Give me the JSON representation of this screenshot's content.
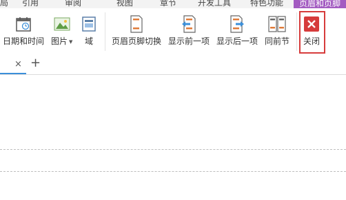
{
  "menu": {
    "tabs": [
      "局",
      "引用",
      "审阅",
      "视图",
      "章节",
      "开发工具",
      "特色功能",
      "页眉和页脚"
    ]
  },
  "ribbon": {
    "date_time": "日期和时间",
    "picture": "图片",
    "field": "域",
    "header_footer_switch": "页眉页脚切换",
    "show_previous": "显示前一项",
    "show_next": "显示后一项",
    "same_as_previous": "同前节",
    "close": "关闭"
  },
  "tabbar": {
    "close_glyph": "×",
    "add_glyph": "+"
  },
  "colors": {
    "active_tab": "#a35bc1",
    "close_red": "#d63b3b",
    "highlight_border": "#d63b3b",
    "tab_underline": "#3b8fd9"
  }
}
